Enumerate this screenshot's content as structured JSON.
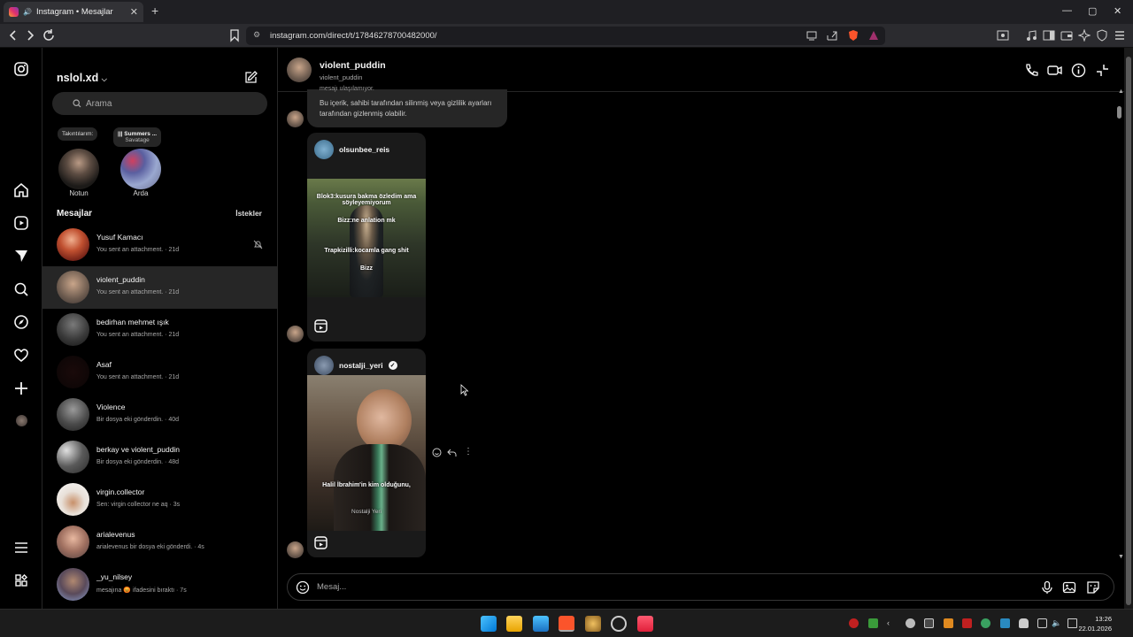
{
  "browser": {
    "tab_title": "Instagram • Mesajlar",
    "url": "instagram.com/direct/t/17846278700482000/"
  },
  "sidebar": {
    "username": "nslol.xd",
    "search_placeholder": "Arama",
    "notes": [
      {
        "bubble": "Takıntılarım:",
        "bubble2": "",
        "name": "Notun"
      },
      {
        "bubble": "||| Summers ...",
        "bubble2": "Savatage",
        "name": "Arda"
      }
    ],
    "messages_title": "Mesajlar",
    "requests_label": "İstekler",
    "conversations": [
      {
        "name": "Yusuf Kamacı",
        "sub": "You sent an attachment. · 21d",
        "muted": true
      },
      {
        "name": "violent_puddin",
        "sub": "You sent an attachment. · 21d",
        "active": true
      },
      {
        "name": "bedirhan mehmet ışık",
        "sub": "You sent an attachment. · 21d"
      },
      {
        "name": "Asaf",
        "sub": "You sent an attachment. · 21d"
      },
      {
        "name": "Violence",
        "sub": "Bir dosya eki gönderdin. · 40d"
      },
      {
        "name": "berkay ve violent_puddin",
        "sub": "Bir dosya eki gönderdin. · 48d"
      },
      {
        "name": "virgin.collector",
        "sub": "Sen: virgin collector ne aq · 3s"
      },
      {
        "name": "arialevenus",
        "sub": "arialevenus bir dosya eki gönderdi. · 4s"
      },
      {
        "name": "_yu_nilsey",
        "sub": "mesajına 😡 ifadesini bıraktı · 7s"
      }
    ]
  },
  "chat": {
    "name": "violent_puddin",
    "username": "violent_puddin",
    "system_message_top": "mesajı ulaşılamıyor.",
    "system_message": "Bu içerik, sahibi tarafından silinmiş veya gizlilik ayarları tarafından gizlenmiş olabilir.",
    "reel1": {
      "account": "olsunbee_reis",
      "captions": [
        "Blok3:kusura bakma özledim ama söyleyemiyorum",
        "Bizz:ne anlation mk",
        "Trapkizilli:kocamla gang shit",
        "Bizz"
      ]
    },
    "reel2": {
      "account": "nostalji_yeri",
      "verified": true,
      "captions": [
        "Halil İbrahim'in kim olduğunu,",
        "Nostalji Yeri"
      ]
    },
    "composer_placeholder": "Mesaj..."
  },
  "taskbar": {
    "time": "13:26",
    "date": "22.01.2026"
  },
  "colors": {
    "background": "#000000",
    "panel": "#262626",
    "accent_instagram": "#e1306c"
  }
}
